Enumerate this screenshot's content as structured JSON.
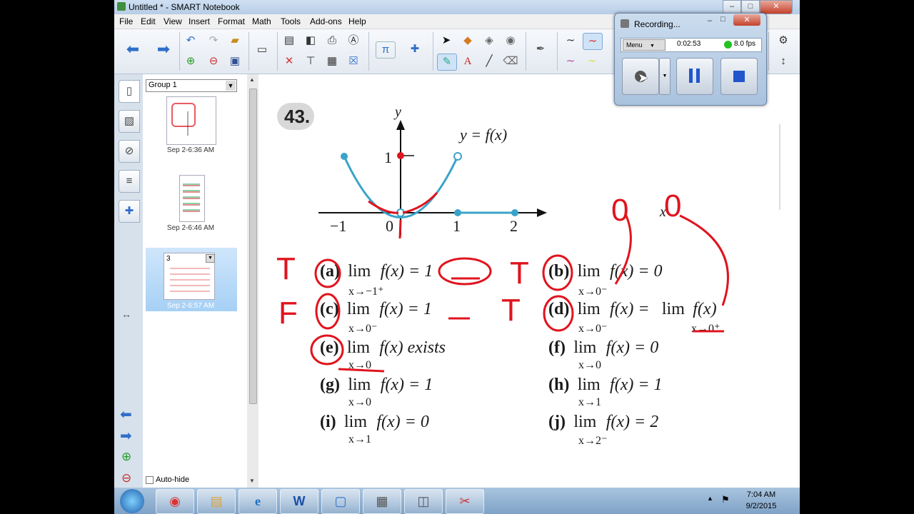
{
  "window": {
    "title": "Untitled * - SMART Notebook",
    "minimize": "–",
    "maximize": "□",
    "close": "✕"
  },
  "menu": [
    "File",
    "Edit",
    "View",
    "Insert",
    "Format",
    "Math",
    "Tools",
    "Add-ons",
    "Help"
  ],
  "sidebar": {
    "group_select": "Group 1",
    "pages": [
      {
        "label": "Sep 2-6:36 AM"
      },
      {
        "label": "Sep 2-6:46 AM"
      },
      {
        "label": "Sep 2-6:57 AM",
        "number": "3"
      }
    ],
    "autohide_label": "Auto-hide"
  },
  "recorder": {
    "title": "Recording...",
    "menu_label": "Menu",
    "elapsed": "0:02:53",
    "fps": "8.0 fps",
    "status_color": "#22c322"
  },
  "problem": {
    "number": "43.",
    "graph": {
      "y_axis": "y",
      "x_axis": "x",
      "function_label": "y = f(x)",
      "x_ticks": [
        "−1",
        "0",
        "1",
        "2"
      ],
      "y_tick": "1"
    },
    "parts": [
      {
        "letter": "(a)",
        "expr": "f(x) = 1",
        "limit": "x→−1⁺"
      },
      {
        "letter": "(b)",
        "expr": "f(x) = 0",
        "limit": "x→0⁻"
      },
      {
        "letter": "(c)",
        "expr": "f(x) = 1",
        "limit": "x→0⁻"
      },
      {
        "letter": "(d)",
        "expr": "f(x) =",
        "limit": "x→0⁻",
        "expr2": "f(x)",
        "limit2": "x→0⁺"
      },
      {
        "letter": "(e)",
        "expr": "f(x) exists",
        "limit": "x→0"
      },
      {
        "letter": "(f)",
        "expr": "f(x) = 0",
        "limit": "x→0"
      },
      {
        "letter": "(g)",
        "expr": "f(x) = 1",
        "limit": "x→0"
      },
      {
        "letter": "(h)",
        "expr": "f(x) = 1",
        "limit": "x→1"
      },
      {
        "letter": "(i)",
        "expr": "f(x) = 0",
        "limit": "x→1"
      },
      {
        "letter": "(j)",
        "expr": "f(x) = 2",
        "limit": "x→2⁻"
      }
    ],
    "lim_word": "lim",
    "handwriting": {
      "a": "T",
      "b": "T",
      "c": "F",
      "d": "T",
      "top1": "0",
      "top2": "0"
    }
  },
  "taskbar": {
    "time": "7:04 AM",
    "date": "9/2/2015"
  },
  "colors": {
    "accent_blue": "#3ba3c9",
    "ink_red": "#e0141e"
  }
}
